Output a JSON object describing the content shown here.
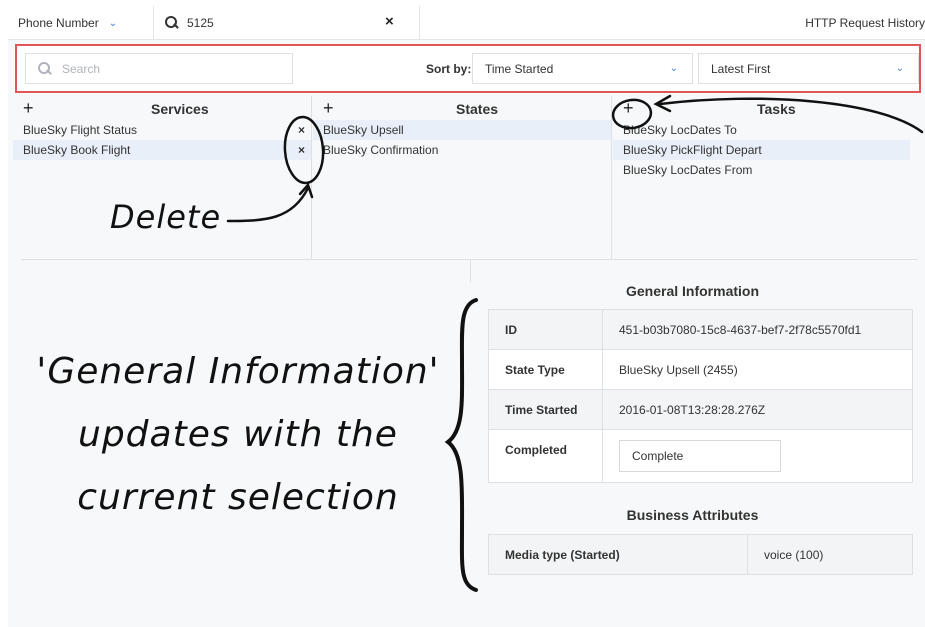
{
  "topbar": {
    "phone_select": "Phone Number",
    "search_value": "5125",
    "clear_icon": "×",
    "http_history": "HTTP Request History"
  },
  "filterbar": {
    "search_placeholder": "Search",
    "sort_label": "Sort by:",
    "sort_field": "Time Started",
    "sort_order": "Latest First"
  },
  "services": {
    "title": "Services",
    "add": "+",
    "items": [
      {
        "label": "BlueSky Flight Status",
        "delete": "×"
      },
      {
        "label": "BlueSky Book Flight",
        "delete": "×"
      }
    ]
  },
  "states": {
    "title": "States",
    "add": "+",
    "items": [
      {
        "label": "BlueSky Upsell"
      },
      {
        "label": "BlueSky Confirmation"
      }
    ]
  },
  "tasks": {
    "title": "Tasks",
    "add": "+",
    "items": [
      {
        "label": "BlueSky LocDates To"
      },
      {
        "label": "BlueSky PickFlight Depart"
      },
      {
        "label": "BlueSky LocDates From"
      }
    ]
  },
  "general_info": {
    "title": "General Information",
    "rows": [
      {
        "key": "ID",
        "value": "451-b03b7080-15c8-4637-bef7-2f78c5570fd1"
      },
      {
        "key": "State Type",
        "value": "BlueSky Upsell (2455)"
      },
      {
        "key": "Time Started",
        "value": "2016-01-08T13:28:28.276Z"
      },
      {
        "key": "Completed",
        "value": "Complete"
      }
    ]
  },
  "business_attributes": {
    "title": "Business Attributes",
    "rows": [
      {
        "key": "Media type (Started)",
        "value": "voice (100)"
      }
    ]
  },
  "annotations": {
    "delete": "Delete",
    "gi_line1": "'General Information'",
    "gi_line2": "updates with  the",
    "gi_line3": "current selection"
  },
  "colors": {
    "highlight_border": "#e05555",
    "selected_row": "#e8eff8",
    "chevron": "#4a7bd0"
  }
}
